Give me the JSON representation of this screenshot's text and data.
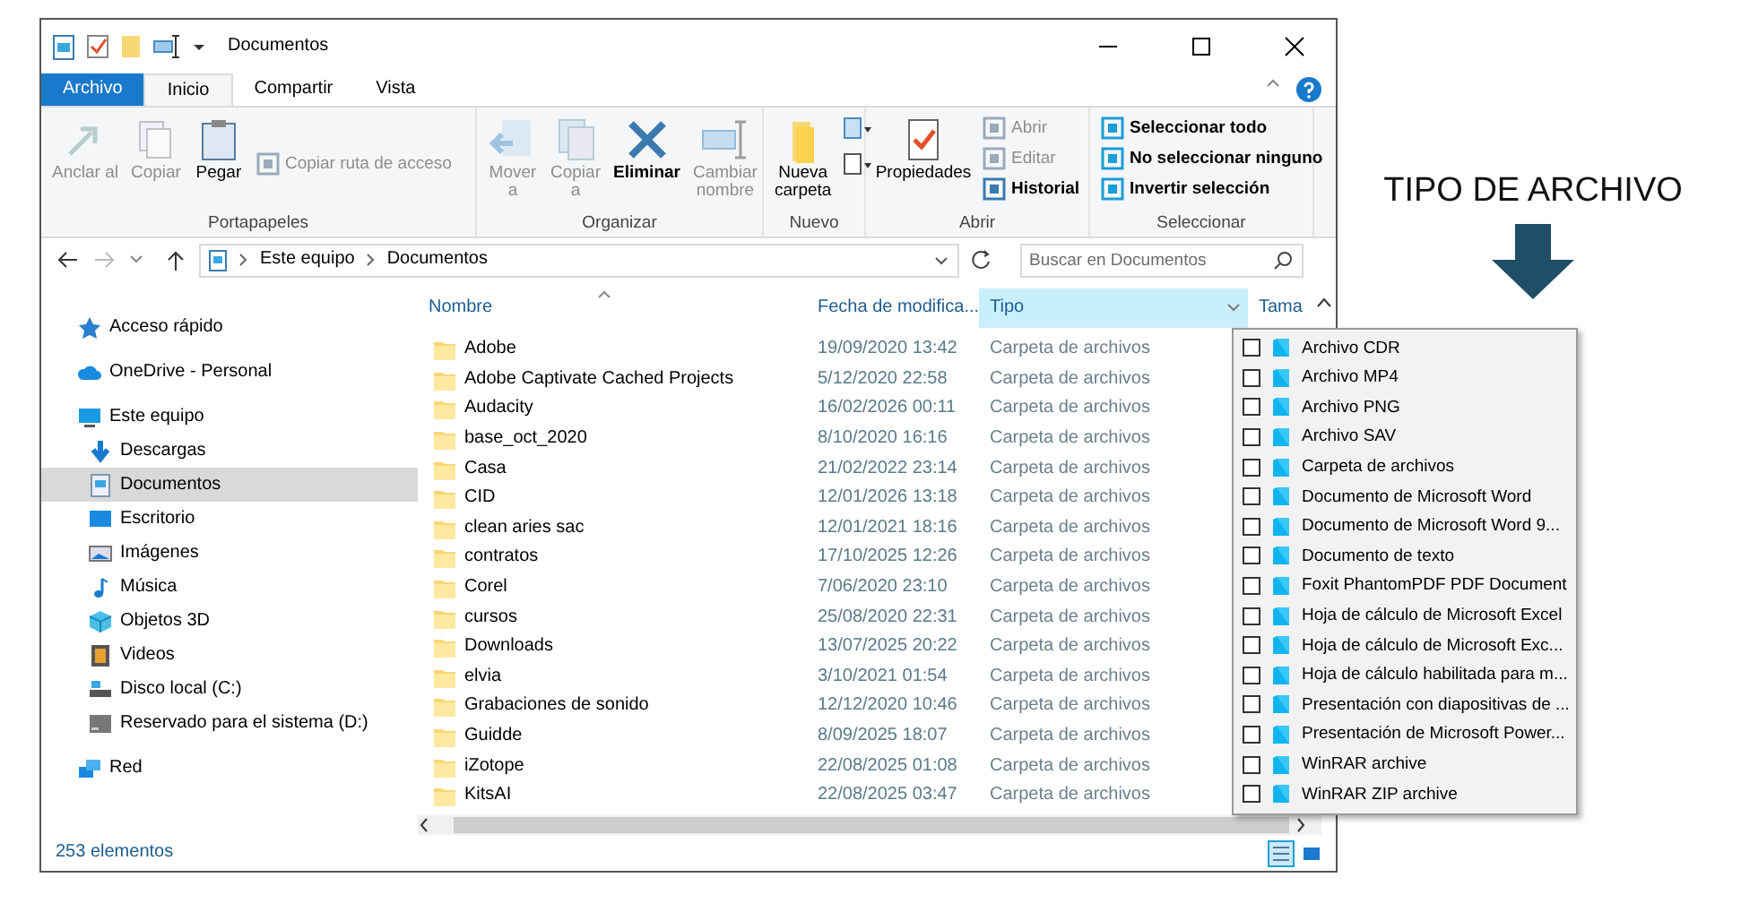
{
  "window": {
    "title": "Documentos"
  },
  "ribbon": {
    "tabs": [
      {
        "label": "Archivo",
        "kind": "file",
        "selected": false
      },
      {
        "label": "Inicio",
        "kind": "tab",
        "selected": true
      },
      {
        "label": "Compartir",
        "kind": "tab",
        "selected": false
      },
      {
        "label": "Vista",
        "kind": "tab",
        "selected": false
      }
    ],
    "groups": [
      {
        "label": "Portapapeles",
        "commands": [
          {
            "label": "Anclar al",
            "kind": "large",
            "disabled": true
          },
          {
            "label": "Copiar",
            "kind": "large",
            "disabled": true
          },
          {
            "label": "Pegar",
            "kind": "large",
            "disabled": false
          },
          {
            "label": "Copiar ruta de acceso",
            "kind": "small",
            "disabled": true
          }
        ]
      },
      {
        "label": "Organizar",
        "commands": [
          {
            "label": "Mover a",
            "kind": "large",
            "disabled": true
          },
          {
            "label": "Copiar a",
            "kind": "large",
            "disabled": true
          },
          {
            "label": "Eliminar",
            "kind": "large",
            "disabled": false
          },
          {
            "label": "Cambiar nombre",
            "kind": "large",
            "disabled": true
          }
        ]
      },
      {
        "label": "Nuevo",
        "commands": [
          {
            "label": "Nueva carpeta",
            "kind": "large",
            "disabled": false
          }
        ]
      },
      {
        "label": "Abrir",
        "commands": [
          {
            "label": "Propiedades",
            "kind": "large",
            "disabled": false
          },
          {
            "label": "Abrir",
            "kind": "small",
            "disabled": true
          },
          {
            "label": "Editar",
            "kind": "small",
            "disabled": true
          },
          {
            "label": "Historial",
            "kind": "small",
            "disabled": false
          }
        ]
      },
      {
        "label": "Seleccionar",
        "commands": [
          {
            "label": "Seleccionar todo",
            "kind": "small",
            "disabled": false
          },
          {
            "label": "No seleccionar ninguno",
            "kind": "small",
            "disabled": false
          },
          {
            "label": "Invertir selección",
            "kind": "small",
            "disabled": false
          }
        ]
      }
    ]
  },
  "address": {
    "path": [
      "Este equipo",
      "Documentos"
    ],
    "search_placeholder": "Buscar en Documentos"
  },
  "sidebar": {
    "items": [
      {
        "label": "Acceso rápido",
        "selected": false
      },
      {
        "label": "OneDrive - Personal",
        "selected": false
      },
      {
        "label": "Este equipo",
        "selected": false,
        "children": [
          {
            "label": "Descargas",
            "selected": false
          },
          {
            "label": "Documentos",
            "selected": true
          },
          {
            "label": "Escritorio",
            "selected": false
          },
          {
            "label": "Imágenes",
            "selected": false
          },
          {
            "label": "Música",
            "selected": false
          },
          {
            "label": "Objetos 3D",
            "selected": false
          },
          {
            "label": "Videos",
            "selected": false
          },
          {
            "label": "Disco local (C:)",
            "selected": false
          },
          {
            "label": "Reservado para el sistema (D:)",
            "selected": false
          }
        ]
      },
      {
        "label": "Red",
        "selected": false
      }
    ]
  },
  "table": {
    "columns": [
      {
        "label": "Nombre",
        "active": false
      },
      {
        "label": "Fecha de modifica...",
        "active": false
      },
      {
        "label": "Tipo",
        "active": true
      },
      {
        "label": "Tama",
        "active": false
      }
    ],
    "rows": [
      {
        "name": "Adobe",
        "date": "19/09/2020 13:42",
        "type": "Carpeta de archivos"
      },
      {
        "name": "Adobe Captivate Cached Projects",
        "date": "5/12/2020 22:58",
        "type": "Carpeta de archivos"
      },
      {
        "name": "Audacity",
        "date": "16/02/2026 00:11",
        "type": "Carpeta de archivos"
      },
      {
        "name": "base_oct_2020",
        "date": "8/10/2020 16:16",
        "type": "Carpeta de archivos"
      },
      {
        "name": "Casa",
        "date": "21/02/2022 23:14",
        "type": "Carpeta de archivos"
      },
      {
        "name": "CID",
        "date": "12/01/2026 13:18",
        "type": "Carpeta de archivos"
      },
      {
        "name": "clean aries sac",
        "date": "12/01/2021 18:16",
        "type": "Carpeta de archivos"
      },
      {
        "name": "contratos",
        "date": "17/10/2025 12:26",
        "type": "Carpeta de archivos"
      },
      {
        "name": "Corel",
        "date": "7/06/2020 23:10",
        "type": "Carpeta de archivos"
      },
      {
        "name": "cursos",
        "date": "25/08/2020 22:31",
        "type": "Carpeta de archivos"
      },
      {
        "name": "Downloads",
        "date": "13/07/2025 20:22",
        "type": "Carpeta de archivos"
      },
      {
        "name": "elvia",
        "date": "3/10/2021 01:54",
        "type": "Carpeta de archivos"
      },
      {
        "name": "Grabaciones de sonido",
        "date": "12/12/2020 10:46",
        "type": "Carpeta de archivos"
      },
      {
        "name": "Guidde",
        "date": "8/09/2025 18:07",
        "type": "Carpeta de archivos"
      },
      {
        "name": "iZotope",
        "date": "22/08/2025 01:08",
        "type": "Carpeta de archivos"
      },
      {
        "name": "KitsAI",
        "date": "22/08/2025 03:47",
        "type": "Carpeta de archivos"
      }
    ]
  },
  "filter_menu": {
    "options": [
      {
        "label": "Archivo CDR",
        "checked": false
      },
      {
        "label": "Archivo MP4",
        "checked": false
      },
      {
        "label": "Archivo PNG",
        "checked": false
      },
      {
        "label": "Archivo SAV",
        "checked": false
      },
      {
        "label": "Carpeta de archivos",
        "checked": false
      },
      {
        "label": "Documento de Microsoft Word",
        "checked": false
      },
      {
        "label": "Documento de Microsoft Word 9...",
        "checked": false
      },
      {
        "label": "Documento de texto",
        "checked": false
      },
      {
        "label": "Foxit PhantomPDF PDF Document",
        "checked": false
      },
      {
        "label": "Hoja de cálculo de Microsoft Excel",
        "checked": false
      },
      {
        "label": "Hoja de cálculo de Microsoft Exc...",
        "checked": false
      },
      {
        "label": "Hoja de cálculo habilitada para m...",
        "checked": false
      },
      {
        "label": "Presentación con diapositivas de ...",
        "checked": false
      },
      {
        "label": "Presentación de Microsoft Power...",
        "checked": false
      },
      {
        "label": "WinRAR archive",
        "checked": false
      },
      {
        "label": "WinRAR ZIP archive",
        "checked": false
      }
    ]
  },
  "status_bar": {
    "text": "253 elementos",
    "views": [
      {
        "kind": "details",
        "selected": true
      },
      {
        "kind": "tiles",
        "selected": false
      }
    ]
  },
  "annotation": {
    "text": "TIPO DE ARCHIVO"
  }
}
